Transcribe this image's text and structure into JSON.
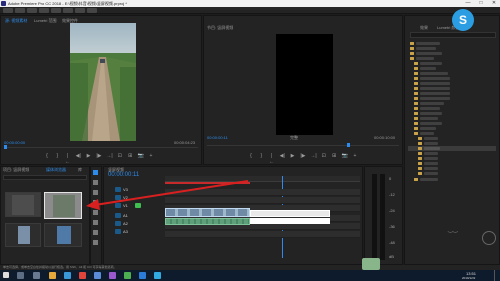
{
  "window": {
    "title": "Adobe Premiere Pro CC 2018 - E:\\视频\\抖音\\视频\\竖屏视频.prproj *",
    "minimize": "—",
    "maximize": "□",
    "close": "✕"
  },
  "source_monitor": {
    "tabs": [
      "源: 视频素材",
      "Lumetri 范围",
      "效果控件"
    ],
    "timecode_left": "00:00:00:00",
    "timecode_right": "00:00:04:23",
    "transport": [
      "{",
      "}",
      "|←",
      "◀|",
      "▶",
      "|▶",
      "→|",
      "⊡",
      "⊞",
      "📷",
      "+"
    ]
  },
  "program_monitor": {
    "tab": "节目: 竖屏视频",
    "timecode_left": "00:00:00:11",
    "zoom": "完整",
    "timecode_right": "00:00:10:00",
    "transport": [
      "{",
      "}",
      "|←",
      "◀|",
      "▶",
      "|▶",
      "→|",
      "⊡",
      "⊞",
      "📷",
      "+"
    ]
  },
  "project_panel": {
    "tabs": [
      "项目: 竖屏视频",
      "媒体浏览器",
      "库"
    ]
  },
  "timeline": {
    "tab": "竖屏视频",
    "timecode": "00:00:00:11",
    "tracks": [
      "V3",
      "V2",
      "V1",
      "A1",
      "A2",
      "A3"
    ],
    "mixer_values": [
      "0",
      "-12",
      "-24",
      "-36",
      "-48",
      "dB"
    ]
  },
  "right_panel": {
    "tabs": [
      "效果",
      "Lumetri 颜色"
    ]
  },
  "status_bar": {
    "message": "单击可选择，或单击空白处并拖动以进行框选。用 Shift、Alt 和 Ctrl 可获得其他选项。"
  },
  "taskbar": {
    "time": "13:51",
    "date": "2019/12/2"
  },
  "overlays": {
    "annotation_arrow_color": "#d92020",
    "watermark_color": "#2b9de2"
  }
}
